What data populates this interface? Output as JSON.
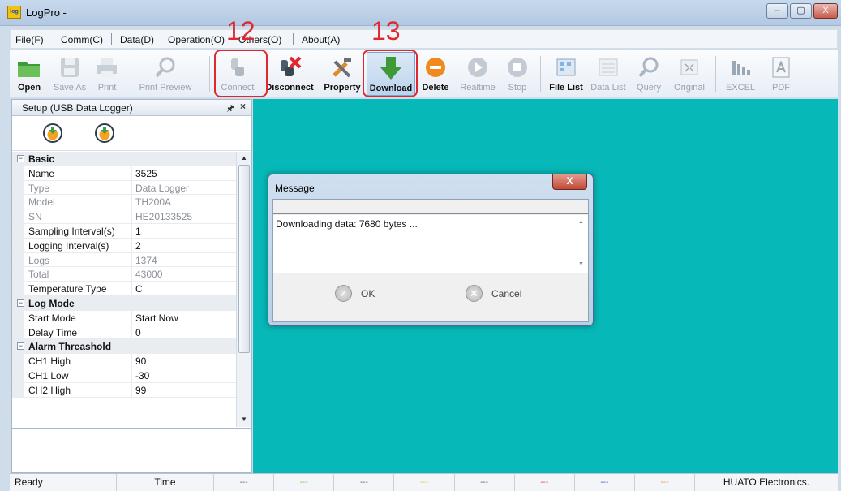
{
  "window": {
    "app_icon_text": "log",
    "title": "LogPro -",
    "controls": [
      "–",
      "▢",
      "X"
    ]
  },
  "menu": {
    "items": [
      "File(F)",
      "Comm(C)",
      "Data(D)",
      "Operation(O)",
      "Others(O)",
      "About(A)"
    ]
  },
  "toolbar": {
    "buttons": [
      {
        "label": "Open",
        "icon": "folder-icon",
        "enabled": true
      },
      {
        "label": "Save As",
        "icon": "save-icon",
        "enabled": false
      },
      {
        "label": "Print",
        "icon": "printer-icon",
        "enabled": false
      },
      {
        "label": "Print Preview",
        "icon": "magnifier-icon",
        "enabled": false
      },
      {
        "label": "Connect",
        "icon": "connect-plug-icon",
        "enabled": false
      },
      {
        "label": "Disconnect",
        "icon": "disconnect-icon",
        "enabled": true
      },
      {
        "label": "Property",
        "icon": "tools-icon",
        "enabled": true
      },
      {
        "label": "Download",
        "icon": "download-arrow-icon",
        "enabled": true
      },
      {
        "label": "Delete",
        "icon": "delete-icon",
        "enabled": true
      },
      {
        "label": "Realtime",
        "icon": "play-icon",
        "enabled": false
      },
      {
        "label": "Stop",
        "icon": "stop-icon",
        "enabled": false
      },
      {
        "label": "File List",
        "icon": "file-list-icon",
        "enabled": true
      },
      {
        "label": "Data List",
        "icon": "data-list-icon",
        "enabled": false
      },
      {
        "label": "Query",
        "icon": "query-icon",
        "enabled": false
      },
      {
        "label": "Original",
        "icon": "original-icon",
        "enabled": false
      },
      {
        "label": "EXCEL",
        "icon": "excel-icon",
        "enabled": false
      },
      {
        "label": "PDF",
        "icon": "pdf-icon",
        "enabled": false
      }
    ]
  },
  "annotations": {
    "connect_number": "12",
    "download_number": "13",
    "color": "#e0282e"
  },
  "panel": {
    "title": "Setup (USB Data Logger)",
    "pin": "ᵖ",
    "close": "×",
    "categories": [
      {
        "name": "Basic",
        "rows": [
          {
            "key": "Name",
            "value": "3525",
            "dim": false
          },
          {
            "key": "Type",
            "value": "Data Logger",
            "dim": true
          },
          {
            "key": "Model",
            "value": "TH200A",
            "dim": true
          },
          {
            "key": "SN",
            "value": "HE20133525",
            "dim": true
          },
          {
            "key": "Sampling Interval(s)",
            "value": "1",
            "dim": false
          },
          {
            "key": "Logging Interval(s)",
            "value": "2",
            "dim": false
          },
          {
            "key": "Logs",
            "value": "1374",
            "dim": true
          },
          {
            "key": "Total",
            "value": "43000",
            "dim": true
          },
          {
            "key": "Temperature Type",
            "value": "C",
            "dim": false
          }
        ]
      },
      {
        "name": "Log Mode",
        "rows": [
          {
            "key": "Start Mode",
            "value": "Start Now",
            "dim": false
          },
          {
            "key": "Delay Time",
            "value": "0",
            "dim": false
          }
        ]
      },
      {
        "name": "Alarm Threashold",
        "rows": [
          {
            "key": "CH1 High",
            "value": "90",
            "dim": false
          },
          {
            "key": "CH1 Low",
            "value": "-30",
            "dim": false
          },
          {
            "key": "CH2 High",
            "value": "99",
            "dim": false
          }
        ]
      }
    ]
  },
  "dialog": {
    "title": "Message",
    "close": "X",
    "message": "Downloading data: 7680 bytes ...",
    "ok_label": "OK",
    "cancel_label": "Cancel"
  },
  "status": {
    "ready": "Ready",
    "time": "Time",
    "dashes": [
      "---",
      "---",
      "---",
      "---",
      "---",
      "---",
      "---",
      "---"
    ],
    "dash_colors": [
      "#666666",
      "#7fbf3f",
      "#666666",
      "#e6c84a",
      "#666666",
      "#e05050",
      "#3b5bd6",
      "#e0a050"
    ],
    "company": "HUATO Electronics."
  }
}
